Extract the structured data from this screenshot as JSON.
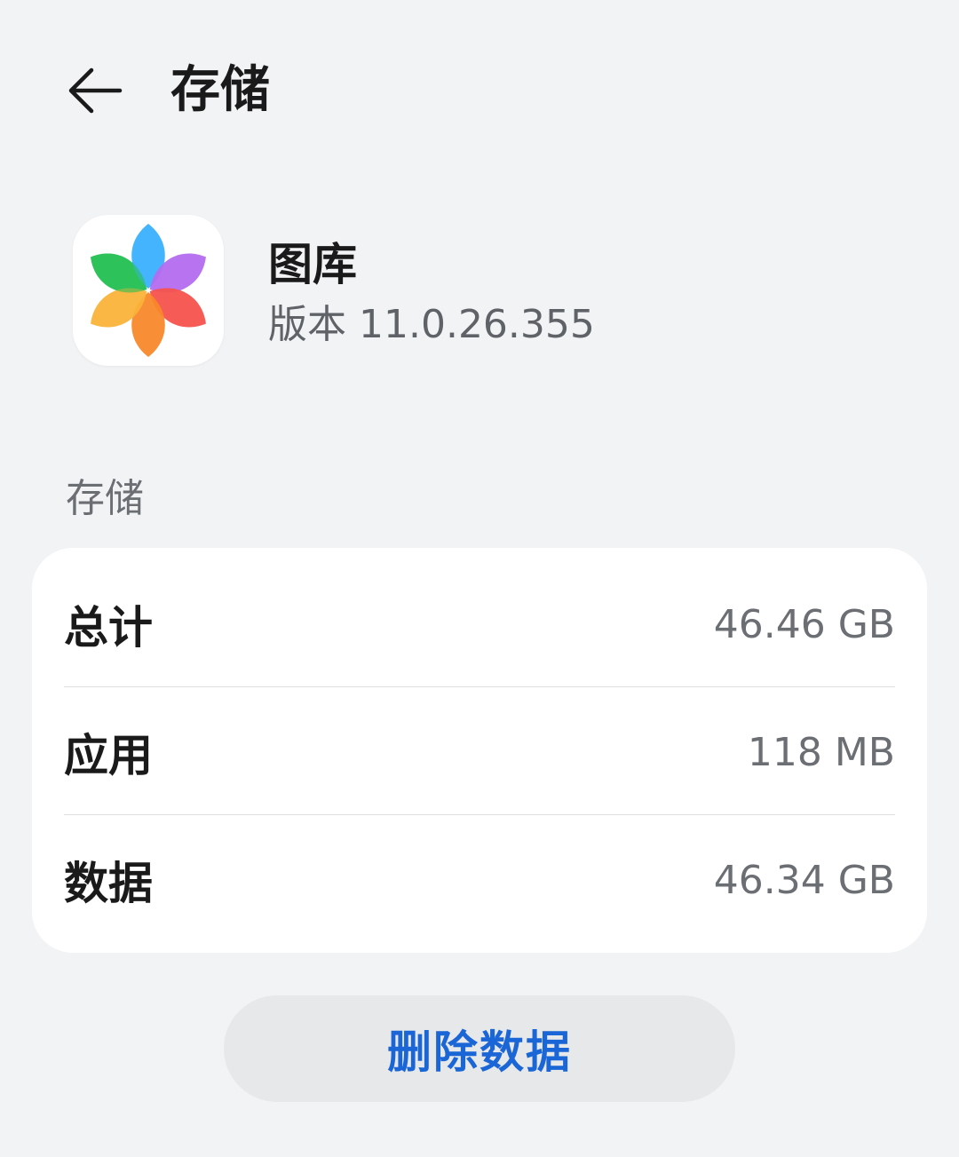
{
  "header": {
    "title": "存储",
    "back_icon": "arrow-left-icon"
  },
  "app": {
    "name": "图库",
    "version": "版本 11.0.26.355",
    "icon": "gallery-flower-icon",
    "icon_colors": [
      "#2fc25a",
      "#3ab0ff",
      "#b46cf0",
      "#f5524d",
      "#fbb33a",
      "#f8882a"
    ]
  },
  "storage": {
    "section_label": "存储",
    "rows": [
      {
        "label": "总计",
        "value": "46.46 GB"
      },
      {
        "label": "应用",
        "value": "118 MB"
      },
      {
        "label": "数据",
        "value": "46.34 GB"
      }
    ]
  },
  "actions": {
    "delete_label": "删除数据",
    "accent_color": "#1b66d6"
  }
}
